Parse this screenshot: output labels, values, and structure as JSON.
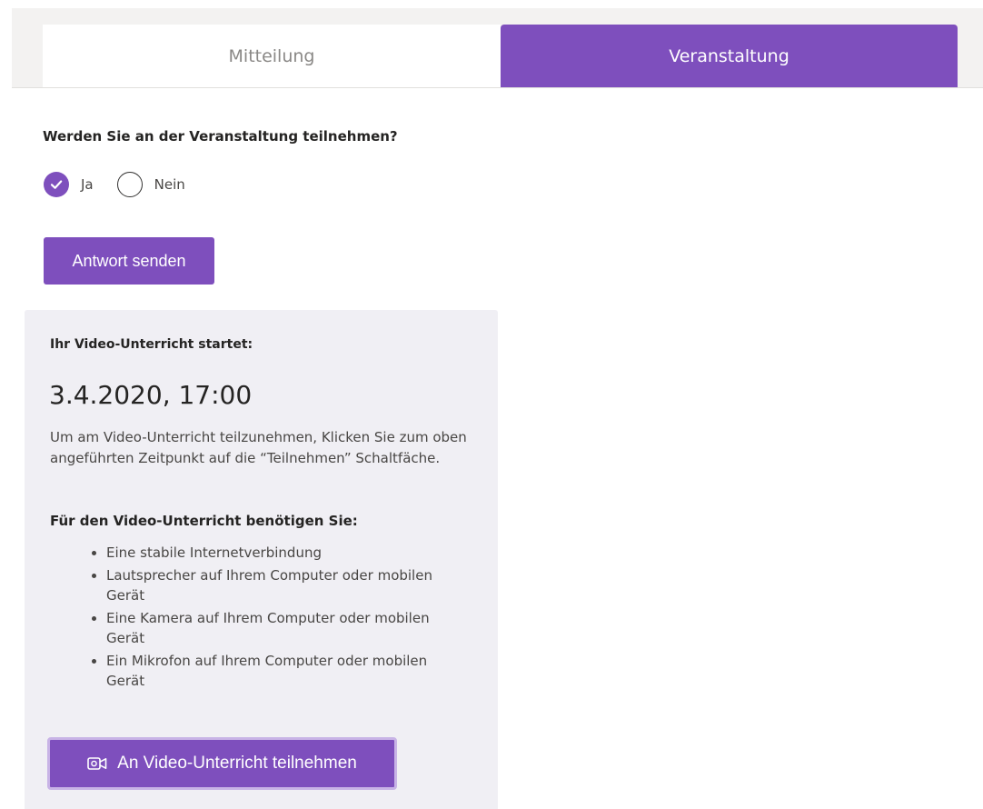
{
  "tabs": [
    {
      "label": "Mitteilung",
      "active": false
    },
    {
      "label": "Veranstaltung",
      "active": true
    }
  ],
  "rsvp": {
    "question": "Werden Sie an der Veranstaltung teilnehmen?",
    "options": [
      {
        "label": "Ja",
        "checked": true
      },
      {
        "label": "Nein",
        "checked": false
      }
    ],
    "submit_label": "Antwort senden"
  },
  "video_lesson": {
    "heading": "Ihr Video-Unterricht startet:",
    "datetime": "3.4.2020, 17:00",
    "description": "Um am Video-Unterricht teilzunehmen, Klicken Sie zum oben angeführten Zeitpunkt auf die “Teilnehmen” Schaltfäche.",
    "requirements_title": "Für den Video-Unterricht benötigen Sie:",
    "requirements": [
      "Eine stabile Internetverbindung",
      "Lautsprecher auf Ihrem Computer oder mobilen Gerät",
      "Eine Kamera auf Ihrem Computer oder mobilen Gerät",
      "Ein Mikrofon auf Ihrem Computer oder mobilen Gerät"
    ],
    "join_label": "An Video-Unterricht teilnehmen",
    "join_icon": "video-camera-icon"
  },
  "colors": {
    "accent": "#7e4fbd",
    "panel_bg": "#f0eff4",
    "tabbar_bg": "#f3f2f1",
    "join_border": "#c8b3e6"
  }
}
